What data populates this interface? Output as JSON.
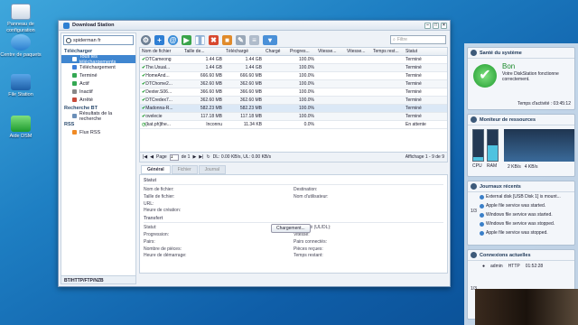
{
  "desktop": {
    "icons": [
      {
        "label": "Panneau de configuration",
        "icon": "control-panel-icon"
      },
      {
        "label": "Centre de paquets",
        "icon": "package-center-icon"
      },
      {
        "label": "File Station",
        "icon": "file-station-icon"
      },
      {
        "label": "Aide DSM",
        "icon": "help-icon"
      }
    ]
  },
  "window": {
    "title": "Download Station",
    "search_value": "spiderman fr",
    "filter_placeholder": "Filtre"
  },
  "sidebar": {
    "download_header": "Télécharger",
    "items": [
      {
        "label": "Tous les téléchargements",
        "color": "#3b7dd8"
      },
      {
        "label": "Téléchargement",
        "color": "#3b7dd8"
      },
      {
        "label": "Terminé",
        "color": "#34a853"
      },
      {
        "label": "Actif",
        "color": "#34a853"
      },
      {
        "label": "Inactif",
        "color": "#888888"
      },
      {
        "label": "Arrêté",
        "color": "#c84a3a"
      }
    ],
    "bt_header": "Recherche BT",
    "bt_item": "Résultats de la recherche",
    "rss_header": "RSS",
    "rss_item": "Flux RSS",
    "footer": "BT/HTTP/FTP/NZB"
  },
  "grid": {
    "columns": [
      "Nom de fichier",
      "Taille de...",
      "Téléchargé",
      "Chargé",
      "Progres...",
      "Vitesse...",
      "Vitesse...",
      "Temps rest...",
      "Statut"
    ],
    "rows": [
      {
        "name": "DTCameong",
        "size": "1.44 GB",
        "downloaded": "1.44 GB",
        "uploaded": "",
        "progress": "100.0%",
        "status": "Terminé"
      },
      {
        "name": "The.Usual...",
        "size": "1.44 GB",
        "downloaded": "1.44 GB",
        "uploaded": "",
        "progress": "100.0%",
        "status": "Terminé"
      },
      {
        "name": "HomeAnd...",
        "size": "666.60 MB",
        "downloaded": "666.60 MB",
        "uploaded": "",
        "progress": "100.0%",
        "status": "Terminé"
      },
      {
        "name": "DTChome2...",
        "size": "362.60 MB",
        "downloaded": "362.60 MB",
        "uploaded": "",
        "progress": "100.0%",
        "status": "Terminé"
      },
      {
        "name": "Dexter.S06...",
        "size": "366.60 MB",
        "downloaded": "366.60 MB",
        "uploaded": "",
        "progress": "100.0%",
        "status": "Terminé"
      },
      {
        "name": "DTCredex7...",
        "size": "362.60 MB",
        "downloaded": "362.60 MB",
        "uploaded": "",
        "progress": "100.0%",
        "status": "Terminé"
      },
      {
        "name": "Madonna-R...",
        "size": "582.23 MB",
        "downloaded": "582.23 MB",
        "uploaded": "",
        "progress": "100.0%",
        "status": "Terminé"
      },
      {
        "name": "ovelecie",
        "size": "117.18 MB",
        "downloaded": "117.18 MB",
        "uploaded": "",
        "progress": "100.0%",
        "status": "Terminé"
      },
      {
        "name": "[kat.ph]the...",
        "size": "Inconnu",
        "downloaded": "11.34 KB",
        "uploaded": "",
        "progress": "0.0%",
        "status": "En attente"
      }
    ]
  },
  "pager": {
    "page_label": "Page",
    "page_value": "1",
    "of_label": "de 1",
    "speed": "DL: 0.00 KB/s, UL: 0.00 KB/s",
    "display": "Affichage 1 - 9 de 9"
  },
  "tabs": [
    "Général",
    "Fichier",
    "Journal"
  ],
  "detail": {
    "section1": "Statut",
    "section2": "Transfert",
    "left1": [
      "Nom de fichier:",
      "Taille de fichier:",
      "URL:",
      "Heure de création:"
    ],
    "right1": [
      "Destination:",
      "Nom d'utilisateur:"
    ],
    "left2": [
      "Statut:",
      "Progression:",
      "Pairs:",
      "Nombre de pièces:",
      "Heure de démarrage:"
    ],
    "right2": [
      "Transféré (UL/DL):",
      "Vitesse:",
      "Pairs connectés:",
      "Pièces reçues:",
      "Temps restant:"
    ],
    "load_button": "Chargement..."
  },
  "right_panel": {
    "health": {
      "title": "Santé du système",
      "status": "Bon",
      "message": "Votre DiskStation fonctionne correctement.",
      "uptime_label": "Temps d'activité : 03:45:12"
    },
    "resources": {
      "title": "Moniteur de ressources",
      "cpu": "CPU",
      "ram": "RAM",
      "rate_up": "2 KB/s",
      "rate_down": "4 KB/s"
    },
    "logs": {
      "title": "Journaux récents",
      "entries": [
        "External disk [USB Disk 1] is mount...",
        "Apple file service was started.",
        "Windows file service was started.",
        "Windows file service was stopped.",
        "Apple file service was stopped."
      ],
      "page": "1/3"
    },
    "connections": {
      "title": "Connexions actuelles",
      "user": "admin",
      "protocol": "HTTP",
      "time": "01:52:28",
      "page": "1/3"
    }
  }
}
